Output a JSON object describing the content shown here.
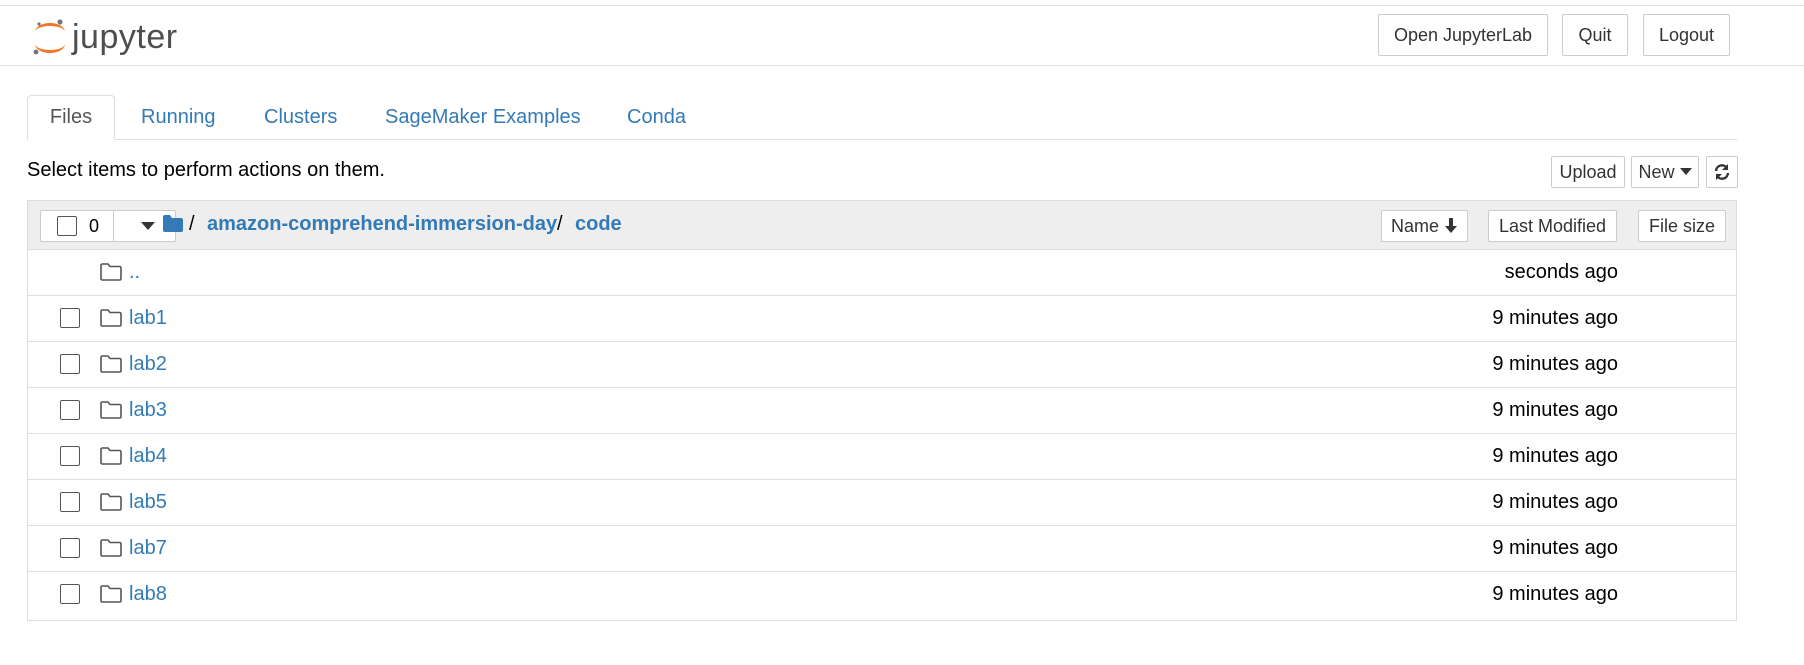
{
  "app": {
    "logo_text": "jupyter",
    "colors": {
      "link": "#337ab7",
      "logo_orange": "#f37726",
      "logo_gray": "#767677"
    }
  },
  "header": {
    "open_jupyterlab": "Open JupyterLab",
    "quit": "Quit",
    "logout": "Logout"
  },
  "tabs": [
    {
      "label": "Files",
      "active": true
    },
    {
      "label": "Running",
      "active": false
    },
    {
      "label": "Clusters",
      "active": false
    },
    {
      "label": "SageMaker Examples",
      "active": false
    },
    {
      "label": "Conda",
      "active": false
    }
  ],
  "toolbar": {
    "hint": "Select items to perform actions on them.",
    "upload": "Upload",
    "new": "New",
    "refresh_icon": "refresh-icon"
  },
  "list": {
    "selected_count": "0",
    "breadcrumb": {
      "root_icon": "folder-icon",
      "sep": "/",
      "parts": [
        "amazon-comprehend-immersion-day",
        "code"
      ]
    },
    "columns": {
      "name": "Name",
      "last_modified": "Last Modified",
      "file_size": "File size"
    },
    "items": [
      {
        "name": "..",
        "modified": "seconds ago",
        "checkbox": false
      },
      {
        "name": "lab1",
        "modified": "9 minutes ago",
        "checkbox": true
      },
      {
        "name": "lab2",
        "modified": "9 minutes ago",
        "checkbox": true
      },
      {
        "name": "lab3",
        "modified": "9 minutes ago",
        "checkbox": true
      },
      {
        "name": "lab4",
        "modified": "9 minutes ago",
        "checkbox": true
      },
      {
        "name": "lab5",
        "modified": "9 minutes ago",
        "checkbox": true
      },
      {
        "name": "lab7",
        "modified": "9 minutes ago",
        "checkbox": true
      },
      {
        "name": "lab8",
        "modified": "9 minutes ago",
        "checkbox": true
      }
    ]
  }
}
